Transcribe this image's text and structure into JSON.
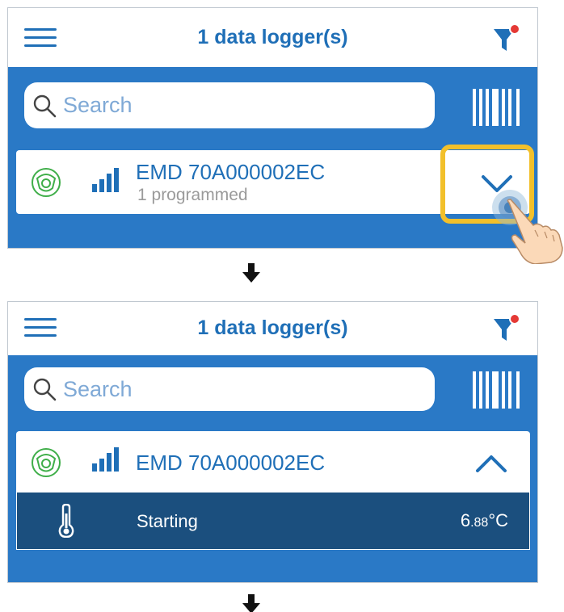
{
  "colors": {
    "brand_blue": "#1f6fb7",
    "panel_blue": "#2a79c6",
    "status_row": "#1b4f7e",
    "sensor_green": "#3fae49",
    "highlight_yellow": "#f2c02b",
    "filter_dot": "#e53935"
  },
  "icons": [
    "hamburger-icon",
    "filter-icon",
    "search-icon",
    "barcode-icon",
    "sensor-icon",
    "signal-strength-icon",
    "chevron-down-icon",
    "chevron-up-icon",
    "thermometer-icon",
    "tap-hand-icon",
    "arrow-down-icon"
  ],
  "step1": {
    "header": {
      "title": "1 data logger(s)"
    },
    "search": {
      "placeholder": "Search"
    },
    "device": {
      "name": "EMD 70A000002EC",
      "subtitle": "1 programmed"
    }
  },
  "step2": {
    "header": {
      "title": "1 data logger(s)"
    },
    "search": {
      "placeholder": "Search"
    },
    "device": {
      "name": "EMD 70A000002EC",
      "status_label": "Starting",
      "temp_main": "6",
      "temp_decimal": ".88",
      "temp_unit": "°C"
    }
  }
}
